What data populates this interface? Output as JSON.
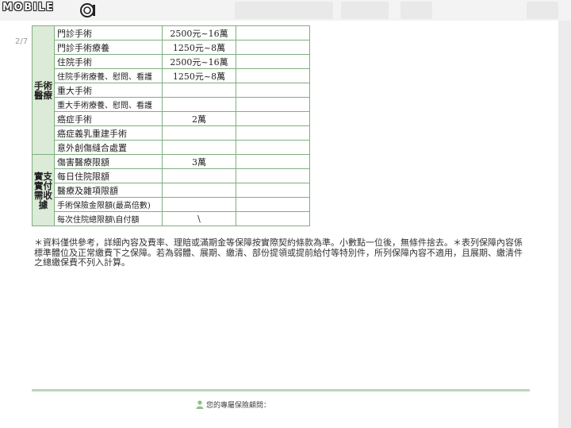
{
  "site": {
    "logo_text": "MOBILE"
  },
  "page": {
    "indicator": "2/7"
  },
  "table": {
    "groups": [
      {
        "title": "手術醫療",
        "rows": [
          {
            "item": "門診手術",
            "value": "2500元~16萬"
          },
          {
            "item": "門診手術療養",
            "value": "1250元~8萬"
          },
          {
            "item": "住院手術",
            "value": "2500元~16萬"
          },
          {
            "item": "住院手術療養、慰問、看護",
            "value": "1250元~8萬"
          },
          {
            "item": "重大手術",
            "value": ""
          },
          {
            "item": "重大手術療養、慰問、看護",
            "value": ""
          },
          {
            "item": "癌症手術",
            "value": "2萬"
          },
          {
            "item": "癌症義乳重建手術",
            "value": ""
          },
          {
            "item": "意外創傷縫合處置",
            "value": ""
          }
        ]
      },
      {
        "title": "實支實付需收據",
        "rows": [
          {
            "item": "傷害醫療限額",
            "value": "3萬"
          },
          {
            "item": "每日住院限額",
            "value": ""
          },
          {
            "item": "醫療及雜項限額",
            "value": ""
          },
          {
            "item": "手術保險金限額(最高倍數)",
            "value": ""
          },
          {
            "item": "每次住院總限額\\自付額",
            "value": "\\"
          }
        ]
      }
    ]
  },
  "note": "＊資料僅供參考，詳細內容及費率、理賠或滿期金等保障按實際契約條款為準。小數點一位後，無條件捨去。＊表列保障內容係標準體位及正常繳費下之保障。若為弱體、展期、繳清、部份提領或提前給付等特別件，所列保障內容不適用，且展期、繳清件之總繳保費不列入計算。",
  "footer": {
    "text": "您的專屬保險顧問："
  },
  "icons": {
    "logo_mark": "mobile01-logo-icon",
    "footer": "person-icon"
  },
  "colors": {
    "table_border": "#7fae7f",
    "category_bg": "#dcebd8",
    "footer_rule": "#b9d6b7"
  }
}
